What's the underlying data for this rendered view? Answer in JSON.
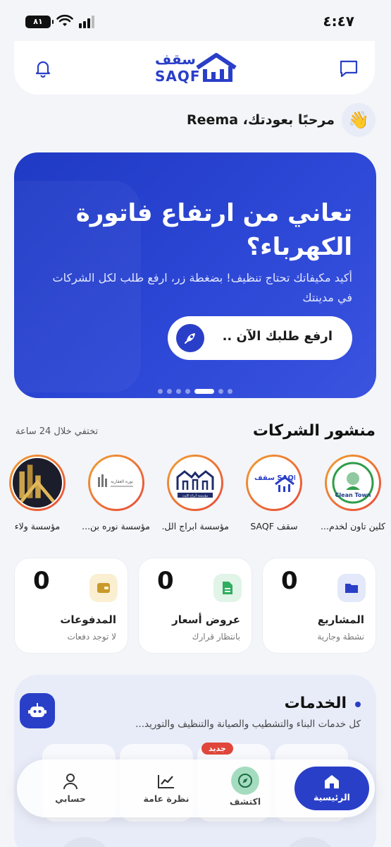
{
  "status_bar": {
    "time": "٤:٤٧",
    "battery": "٨١"
  },
  "header": {
    "logo_ar": "سقف",
    "logo_en": "SAQF"
  },
  "greeting": {
    "text": "مرحبًا بعودتك، Reema"
  },
  "banner": {
    "title": "تعاني من ارتفاع فاتورة الكهرباء؟",
    "subtitle": "أكيد مكيفاتك تحتاج تنظيف! بضغطة زر، ارفع طلب لكل الشركات في مدينتك",
    "button_label": "ارفع طلبك الآن ..",
    "slide_count": 7,
    "active_slide": 4
  },
  "companies": {
    "title": "منشور الشركات",
    "note": "تختفي خلال 24 ساعة",
    "items": [
      {
        "name": "كلين تاون لخدم...",
        "logo_text": "Clean Town"
      },
      {
        "name": "سقف SAQF",
        "logo_text": "سقف SAQF"
      },
      {
        "name": "مؤسسة ابراج الل...",
        "logo_text": "مؤسسة أبراج اللبث"
      },
      {
        "name": "مؤسسة نوره بن...",
        "logo_text": "نوره العقارية"
      },
      {
        "name": "مؤسسة ولاء",
        "logo_text": ""
      }
    ]
  },
  "stats": [
    {
      "value": "0",
      "label": "المشاريع",
      "sub": "نشطة وجارية",
      "icon": "folder-icon",
      "color": "#2a3fc8",
      "bg": "#e3e8fa"
    },
    {
      "value": "0",
      "label": "عروض أسعار",
      "sub": "بانتظار قرارك",
      "icon": "document-icon",
      "color": "#2fae5f",
      "bg": "#e1f4e8"
    },
    {
      "value": "0",
      "label": "المدفوعات",
      "sub": "لا توجد دفعات",
      "icon": "wallet-icon",
      "color": "#c99a2a",
      "bg": "#fbefd2"
    }
  ],
  "services": {
    "title": "الخدمات",
    "subtitle": "كل خدمات البناء والتشطيب والصيانة والتنظيف والتوريد...",
    "new_badge": "جديد"
  },
  "bottom_nav": [
    {
      "label": "الرئيسية",
      "icon": "home-icon",
      "active": true
    },
    {
      "label": "اكتشف",
      "icon": "compass-icon",
      "active": false
    },
    {
      "label": "نظرة عامة",
      "icon": "chart-icon",
      "active": false
    },
    {
      "label": "حسابي",
      "icon": "user-icon",
      "active": false
    }
  ]
}
